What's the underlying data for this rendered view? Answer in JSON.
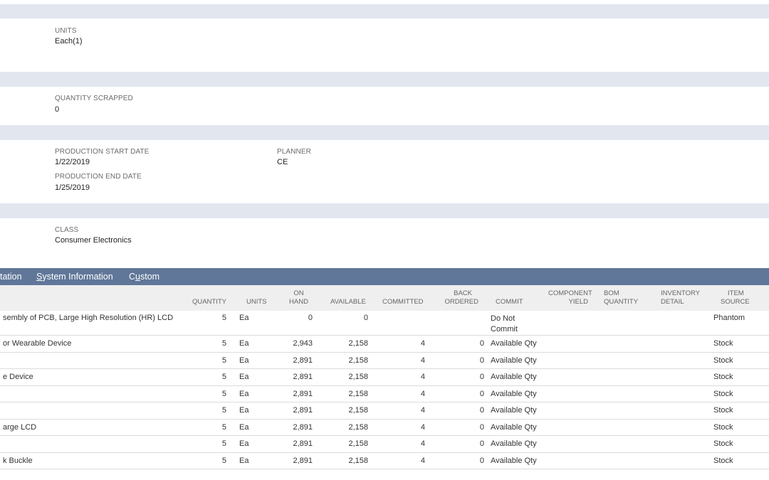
{
  "sections": {
    "units": {
      "label": "UNITS",
      "value": "Each(1)"
    },
    "quantity_scrapped": {
      "label": "QUANTITY SCRAPPED",
      "value": "0"
    },
    "production_start_date": {
      "label": "PRODUCTION START DATE",
      "value": "1/22/2019"
    },
    "production_end_date": {
      "label": "PRODUCTION END DATE",
      "value": "1/25/2019"
    },
    "planner": {
      "label": "PLANNER",
      "value": "CE"
    },
    "class": {
      "label": "CLASS",
      "value": "Consumer Electronics"
    }
  },
  "tabs": [
    {
      "label": "tation"
    },
    {
      "pre": "",
      "u": "S",
      "post": "ystem Information"
    },
    {
      "pre": "C",
      "u": "u",
      "post": "stom"
    }
  ],
  "table": {
    "headers": {
      "item": "",
      "quantity": "QUANTITY",
      "units": "UNITS",
      "on_hand": [
        "ON",
        "HAND"
      ],
      "available": "AVAILABLE",
      "committed": "COMMITTED",
      "back_ordered": [
        "BACK",
        "ORDERED"
      ],
      "commit": "COMMIT",
      "component_yield": [
        "COMPONENT",
        "YIELD"
      ],
      "bom_quantity": [
        "BOM",
        "QUANTITY"
      ],
      "inventory_detail": [
        "INVENTORY",
        "DETAIL"
      ],
      "item_source": [
        "ITEM",
        "SOURCE"
      ]
    },
    "rows": [
      {
        "item": "sembly of PCB, Large High Resolution (HR) LCD",
        "quantity": "5",
        "units": "Ea",
        "on_hand": "0",
        "available": "0",
        "committed": "",
        "back_ordered": "",
        "commit": "Do Not Commit",
        "component_yield": "",
        "bom_quantity": "",
        "inventory_detail": "",
        "item_source": "Phantom"
      },
      {
        "item": "or Wearable Device",
        "quantity": "5",
        "units": "Ea",
        "on_hand": "2,943",
        "available": "2,158",
        "committed": "4",
        "back_ordered": "0",
        "commit": "Available Qty",
        "component_yield": "",
        "bom_quantity": "",
        "inventory_detail": "",
        "item_source": "Stock"
      },
      {
        "item": "",
        "quantity": "5",
        "units": "Ea",
        "on_hand": "2,891",
        "available": "2,158",
        "committed": "4",
        "back_ordered": "0",
        "commit": "Available Qty",
        "component_yield": "",
        "bom_quantity": "",
        "inventory_detail": "",
        "item_source": "Stock"
      },
      {
        "item": "e Device",
        "quantity": "5",
        "units": "Ea",
        "on_hand": "2,891",
        "available": "2,158",
        "committed": "4",
        "back_ordered": "0",
        "commit": "Available Qty",
        "component_yield": "",
        "bom_quantity": "",
        "inventory_detail": "",
        "item_source": "Stock"
      },
      {
        "item": "",
        "quantity": "5",
        "units": "Ea",
        "on_hand": "2,891",
        "available": "2,158",
        "committed": "4",
        "back_ordered": "0",
        "commit": "Available Qty",
        "component_yield": "",
        "bom_quantity": "",
        "inventory_detail": "",
        "item_source": "Stock"
      },
      {
        "item": "",
        "quantity": "5",
        "units": "Ea",
        "on_hand": "2,891",
        "available": "2,158",
        "committed": "4",
        "back_ordered": "0",
        "commit": "Available Qty",
        "component_yield": "",
        "bom_quantity": "",
        "inventory_detail": "",
        "item_source": "Stock"
      },
      {
        "item": "arge LCD",
        "quantity": "5",
        "units": "Ea",
        "on_hand": "2,891",
        "available": "2,158",
        "committed": "4",
        "back_ordered": "0",
        "commit": "Available Qty",
        "component_yield": "",
        "bom_quantity": "",
        "inventory_detail": "",
        "item_source": "Stock"
      },
      {
        "item": "",
        "quantity": "5",
        "units": "Ea",
        "on_hand": "2,891",
        "available": "2,158",
        "committed": "4",
        "back_ordered": "0",
        "commit": "Available Qty",
        "component_yield": "",
        "bom_quantity": "",
        "inventory_detail": "",
        "item_source": "Stock"
      },
      {
        "item": "k Buckle",
        "quantity": "5",
        "units": "Ea",
        "on_hand": "2,891",
        "available": "2,158",
        "committed": "4",
        "back_ordered": "0",
        "commit": "Available Qty",
        "component_yield": "",
        "bom_quantity": "",
        "inventory_detail": "",
        "item_source": "Stock"
      }
    ]
  }
}
